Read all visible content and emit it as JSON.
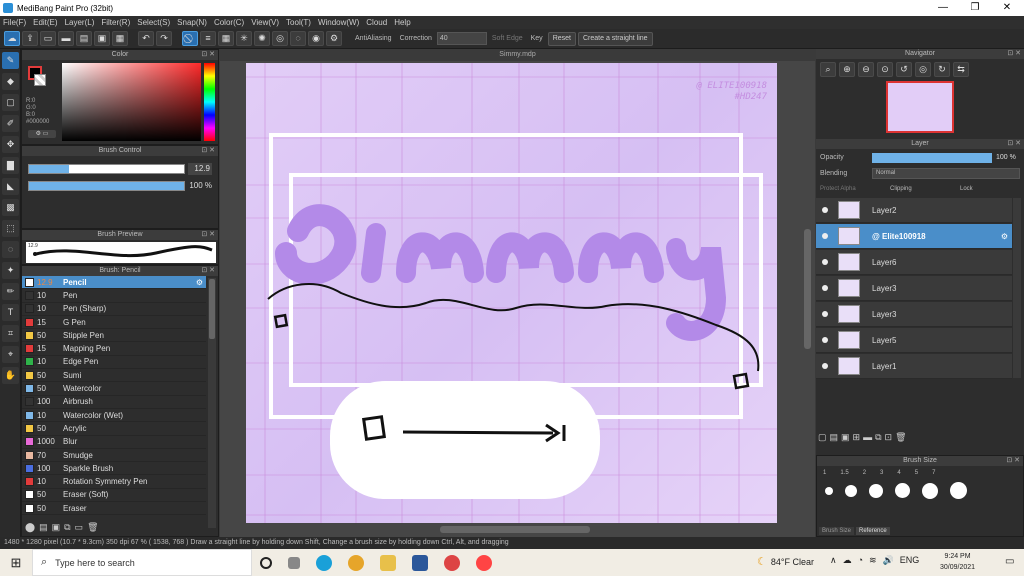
{
  "window": {
    "title": "MediBang Paint Pro (32bit)",
    "min": "—",
    "max": "❐",
    "close": "✕"
  },
  "menu": [
    "File(F)",
    "Edit(E)",
    "Layer(L)",
    "Filter(R)",
    "Select(S)",
    "Snap(N)",
    "Color(C)",
    "View(V)",
    "Tool(T)",
    "Window(W)",
    "Cloud",
    "Help"
  ],
  "toolbar": {
    "antialiasing": "AntiAliasing",
    "correction_label": "Correction",
    "correction_value": "40",
    "soft_edge": "Soft Edge",
    "key": "Key",
    "reset": "Reset",
    "straight_line": "Create a straight line"
  },
  "color_panel": {
    "title": "Color",
    "r": "R:0",
    "g": "G:0",
    "b": "B:0",
    "hex": "#000000",
    "foreground": "#000000",
    "hue_color": "#ff2a2a"
  },
  "brush_control": {
    "title": "Brush Control",
    "size": "12.9",
    "opacity": "100 %",
    "size_fraction": 0.26,
    "opacity_fraction": 1.0
  },
  "brush_preview": {
    "title": "Brush Preview",
    "size_text": "12.9"
  },
  "brush_list": {
    "title": "Brush: Pencil",
    "items": [
      {
        "num": "12.9",
        "name": "Pencil",
        "color": "#ffffff"
      },
      {
        "num": "10",
        "name": "Pen",
        "color": "#333333"
      },
      {
        "num": "10",
        "name": "Pen (Sharp)",
        "color": "#333333"
      },
      {
        "num": "15",
        "name": "G Pen",
        "color": "#e23b3b"
      },
      {
        "num": "50",
        "name": "Stipple Pen",
        "color": "#f2c744"
      },
      {
        "num": "15",
        "name": "Mapping Pen",
        "color": "#e23b3b"
      },
      {
        "num": "10",
        "name": "Edge Pen",
        "color": "#2fb34a"
      },
      {
        "num": "50",
        "name": "Sumi",
        "color": "#f2c744"
      },
      {
        "num": "50",
        "name": "Watercolor",
        "color": "#7fb8e8"
      },
      {
        "num": "100",
        "name": "Airbrush",
        "color": "#333333"
      },
      {
        "num": "10",
        "name": "Watercolor (Wet)",
        "color": "#7fb8e8"
      },
      {
        "num": "50",
        "name": "Acrylic",
        "color": "#f2c744"
      },
      {
        "num": "1000",
        "name": "Blur",
        "color": "#e86ad8"
      },
      {
        "num": "70",
        "name": "Smudge",
        "color": "#e8b8a0"
      },
      {
        "num": "100",
        "name": "Sparkle Brush",
        "color": "#4a6ee0"
      },
      {
        "num": "10",
        "name": "Rotation Symmetry Pen",
        "color": "#e23b3b"
      },
      {
        "num": "50",
        "name": "Eraser (Soft)",
        "color": "#ffffff"
      },
      {
        "num": "50",
        "name": "Eraser",
        "color": "#ffffff"
      }
    ]
  },
  "document": {
    "tab": "Simmy.mdp",
    "watermark_line1": "@ ELITE100918",
    "watermark_line2": "#HD247",
    "art_title": "Simmy"
  },
  "navigator": {
    "title": "Navigator"
  },
  "layer_panel": {
    "title": "Layer",
    "opacity_label": "Opacity",
    "opacity_value": "100 %",
    "blending_label": "Blending",
    "blending_value": "Normal",
    "protect_alpha": "Protect Alpha",
    "clipping": "Clipping",
    "lock": "Lock",
    "layers": [
      {
        "name": "Layer2",
        "selected": false
      },
      {
        "name": "@ Elite100918",
        "selected": true
      },
      {
        "name": "Layer6",
        "selected": false
      },
      {
        "name": "Layer3",
        "selected": false
      },
      {
        "name": "Layer3",
        "selected": false
      },
      {
        "name": "Layer5",
        "selected": false
      },
      {
        "name": "Layer1",
        "selected": false
      }
    ]
  },
  "brush_size": {
    "title": "Brush Size",
    "values": [
      "1",
      "1.5",
      "2",
      "3",
      "4",
      "5",
      "7"
    ],
    "tabs": [
      "Brush Size",
      "Reference"
    ]
  },
  "status": "1480 * 1280 pixel  (10.7 * 9.3cm)  350 dpi  67 %  ( 1538, 768 )  Draw a straight line by holding down Shift, Change a brush size by holding down Ctrl, Alt, and dragging",
  "taskbar": {
    "search_placeholder": "Type here to search",
    "weather": "84°F Clear",
    "lang": "ENG",
    "time": "9:24 PM",
    "date": "30/09/2021"
  }
}
